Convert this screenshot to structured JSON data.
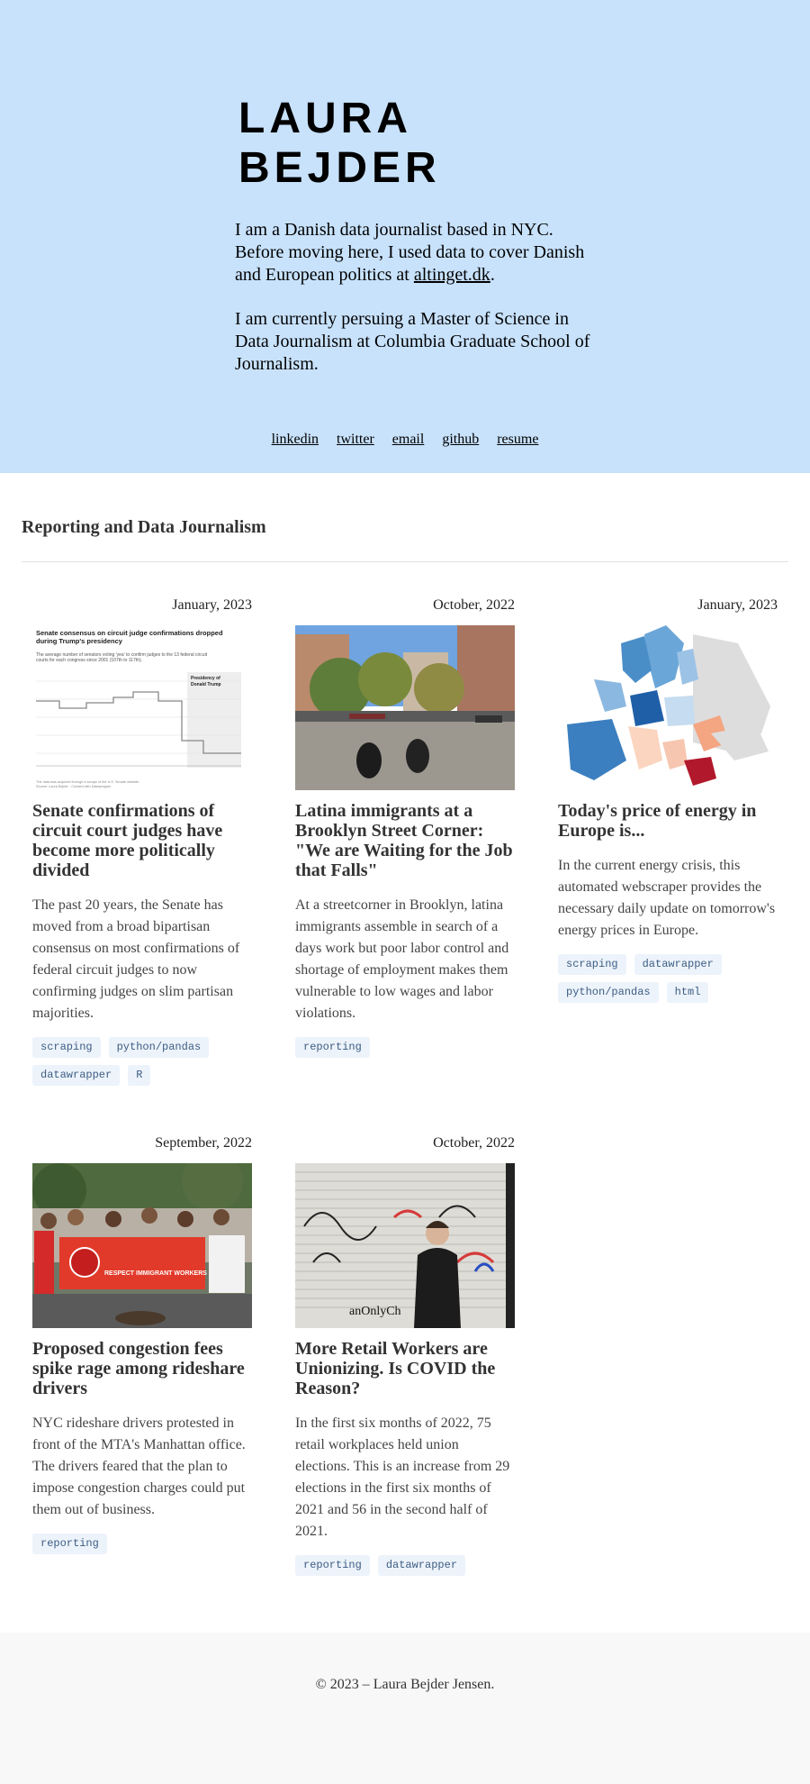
{
  "hero": {
    "name_line1": "LAURA",
    "name_line2": "BEJDER",
    "intro_before_link": "I am a Danish data journalist based in NYC. Before moving here, I used data to cover Danish and European politics at ",
    "intro_link": "altinget.dk",
    "intro_after_link": ".",
    "study": "I am currently persuing a Master of Science in Data Journalism at Columbia Graduate School of Journalism.",
    "background_color": "#c8e2fc"
  },
  "social_links": [
    "linkedin",
    "twitter",
    "email",
    "github",
    "resume"
  ],
  "section": {
    "title": "Reporting and Data Journalism"
  },
  "cards": [
    {
      "date": "January, 2023",
      "title": "Senate confirmations of circuit court judges have become more politically divided",
      "description": "The past 20 years, the Senate has moved from a broad bipartisan consensus on most confirmations of federal circuit judges to now confirming judges on slim partisan majorities.",
      "tags": [
        "scraping",
        "python/pandas",
        "datawrapper",
        "R"
      ],
      "image": "chart-thumbnail",
      "thumb": {
        "title": "Senate consensus on circuit judge confirmations dropped during Trump's presidency",
        "subtitle": "The average number of senators voting 'yea' to confirm judges to the 13 federal circuit courts for each congress since 2001 (107th to 117th).",
        "annotation_1": "Presidency of",
        "annotation_2": "Donald Trump",
        "note": "The data was acquired through a scrape of the U.S. Senate website.",
        "source": "Source: Laura Bejder · Created with Datawrapper"
      }
    },
    {
      "date": "October, 2022",
      "title": "Latina immigrants at a Brooklyn Street Corner: \"We are Waiting for the Job that Falls\"",
      "description": "At a streetcorner in Brooklyn, latina immigrants assemble in search of a days work but poor labor control and shortage of employment makes them vulnerable to low wages and labor violations.",
      "tags": [
        "reporting"
      ],
      "image": "street-corner-photo"
    },
    {
      "date": "January, 2023",
      "title": "Today's price of energy in Europe is...",
      "description": "In the current energy crisis, this automated webscraper provides the necessary daily update on tomorrow's energy prices in Europe.",
      "tags": [
        "scraping",
        "datawrapper",
        "python/pandas",
        "html"
      ],
      "image": "europe-map"
    },
    {
      "date": "September, 2022",
      "title": "Proposed congestion fees spike rage among rideshare drivers",
      "description": "NYC rideshare drivers protested in front of the MTA's Manhattan office. The drivers feared that the plan to impose congestion charges could put them out of business.",
      "tags": [
        "reporting"
      ],
      "image": "protest-photo",
      "banner_text": "RESPECT IMMIGRANT WORKERS"
    },
    {
      "date": "October, 2022",
      "title": "More Retail Workers are Unionizing. Is COVID the Reason?",
      "description": "In the first six months of 2022, 75 retail workplaces held union elections. This is an increase from 29 elections in the first six months of 2021 and 56 in the second half of 2021.",
      "tags": [
        "reporting",
        "datawrapper"
      ],
      "image": "graffiti-portrait-photo",
      "graffiti_text": "anOnlyCh"
    }
  ],
  "footer": {
    "text": "© 2023 – Laura Bejder Jensen."
  }
}
